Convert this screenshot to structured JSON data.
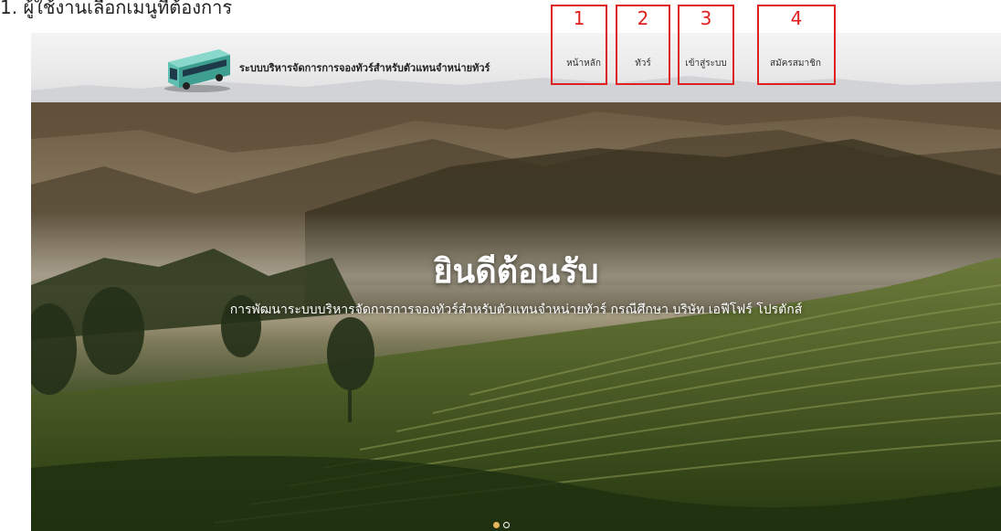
{
  "caption": "1. ผู้ใช้งานเลือกเมนูที่ต้องการ",
  "brand": {
    "title": "ระบบบริหารจัดการการจองทัวร์สำหรับตัวแทนจำหน่ายทัวร์",
    "logo_icon": "bus-icon"
  },
  "nav": {
    "items": [
      {
        "label": "หน้าหลัก",
        "number": "1"
      },
      {
        "label": "ทัวร์",
        "number": "2"
      },
      {
        "label": "เข้าสู่ระบบ",
        "number": "3"
      },
      {
        "label": "สมัครสมาชิก",
        "number": "4"
      }
    ]
  },
  "hero": {
    "title": "ยินดีต้อนรับ",
    "subtitle": "การพัฒนาระบบบริหารจัดการการจองทัวร์สำหรับตัวแทนจำหน่ายทัวร์ กรณีศึกษา บริษัท เอฟีโฟร์ โปรตักส์"
  },
  "carousel": {
    "active_index": 0,
    "total": 2
  },
  "colors": {
    "annotation": "#e02020",
    "active_dot": "#e8b45a",
    "bus": "#5fbfb0"
  }
}
